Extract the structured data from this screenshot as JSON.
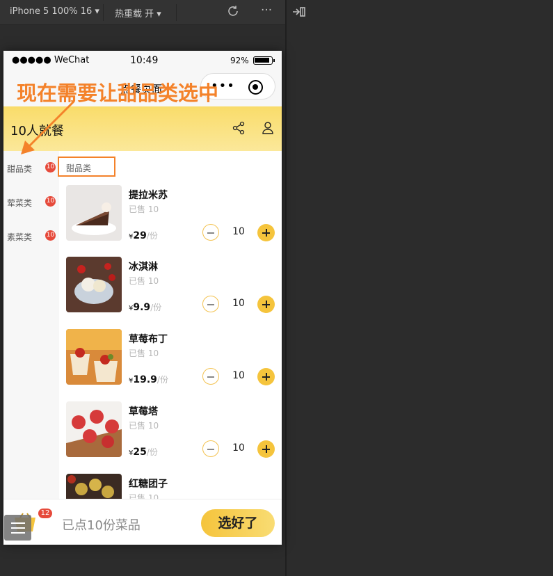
{
  "simulator": {
    "device_label": "iPhone 5 100% 16 ▾",
    "hot_reload_label": "热重载 开 ▾",
    "status": {
      "carrier": "●●●●● WeChat",
      "time": "10:49",
      "battery_pct": "92%"
    },
    "nav_title": "点餐页面"
  },
  "header": {
    "title": "10人就餐"
  },
  "categories": [
    {
      "label": "甜品类",
      "badge": "10"
    },
    {
      "label": "荤菜类",
      "badge": "10"
    },
    {
      "label": "素菜类",
      "badge": "10"
    }
  ],
  "section_title": "甜品类",
  "items": [
    {
      "name": "提拉米苏",
      "sold": "已售 10",
      "currency": "¥",
      "price": "29",
      "unit": "/份",
      "qty": "10"
    },
    {
      "name": "冰淇淋",
      "sold": "已售 10",
      "currency": "¥",
      "price": "9.9",
      "unit": "/份",
      "qty": "10"
    },
    {
      "name": "草莓布丁",
      "sold": "已售 10",
      "currency": "¥",
      "price": "19.9",
      "unit": "/份",
      "qty": "10"
    },
    {
      "name": "草莓塔",
      "sold": "已售 10",
      "currency": "¥",
      "price": "25",
      "unit": "/份",
      "qty": "10"
    },
    {
      "name": "红糖团子",
      "sold": "已售 10",
      "currency": "¥",
      "price": "",
      "unit": "",
      "qty": ""
    }
  ],
  "footer": {
    "cart_badge": "12",
    "summary": "已点10份菜品",
    "checkout_label": "选好了"
  },
  "annotation": {
    "text": "现在需要让甜品类选中"
  },
  "colors": {
    "accent": "#f5c43c",
    "header_bg": "#f9dc6a",
    "badge": "#e64a3b",
    "annotation": "#f4822a"
  }
}
